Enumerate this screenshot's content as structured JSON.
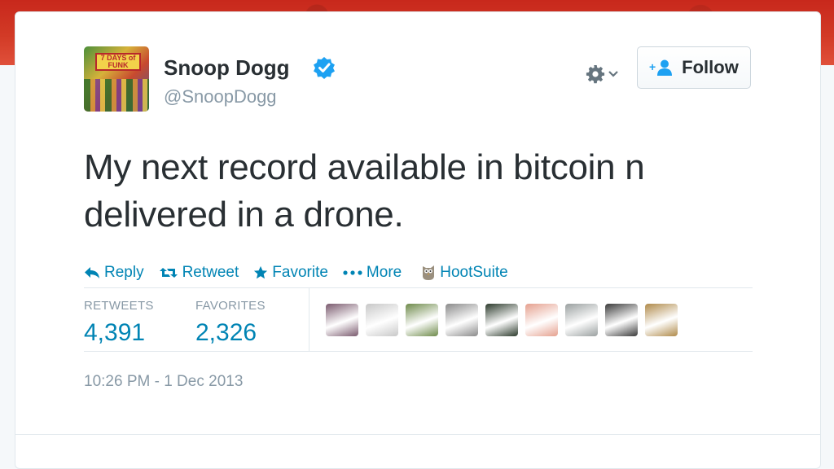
{
  "author": {
    "name": "Snoop Dogg",
    "handle": "@SnoopDogg",
    "verified": true,
    "avatar_text": "7 DAYS of FUNK"
  },
  "header": {
    "follow_label": "Follow",
    "gear_icon": "gear-icon",
    "follow_icon": "add-user-icon"
  },
  "tweet": {
    "text_line1": "My next record available in bitcoin n",
    "text_line2": "delivered in a drone."
  },
  "actions": [
    {
      "label": "Reply",
      "icon": "reply-icon"
    },
    {
      "label": "Retweet",
      "icon": "retweet-icon"
    },
    {
      "label": "Favorite",
      "icon": "star-icon"
    },
    {
      "label": "More",
      "icon": "more-dots-icon"
    },
    {
      "label": "HootSuite",
      "icon": "hootsuite-owl-icon"
    }
  ],
  "stats": {
    "retweets_label": "RETWEETS",
    "retweets_value": "4,391",
    "favorites_label": "FAVORITES",
    "favorites_value": "2,326"
  },
  "favoriters": [
    {
      "color": "#7a5a6e"
    },
    {
      "color": "#c8c8c8"
    },
    {
      "color": "#6e8a4a"
    },
    {
      "color": "#8a8a8a"
    },
    {
      "color": "#2c3a2c"
    },
    {
      "color": "#e5a08e"
    },
    {
      "color": "#9aa0a0"
    },
    {
      "color": "#3a3a3a"
    },
    {
      "color": "#b08a4a"
    }
  ],
  "timestamp": "10:26 PM - 1 Dec 2013",
  "colors": {
    "link": "#0084b4",
    "text": "#292f33",
    "muted": "#8899a6",
    "verified": "#1da1f2"
  }
}
